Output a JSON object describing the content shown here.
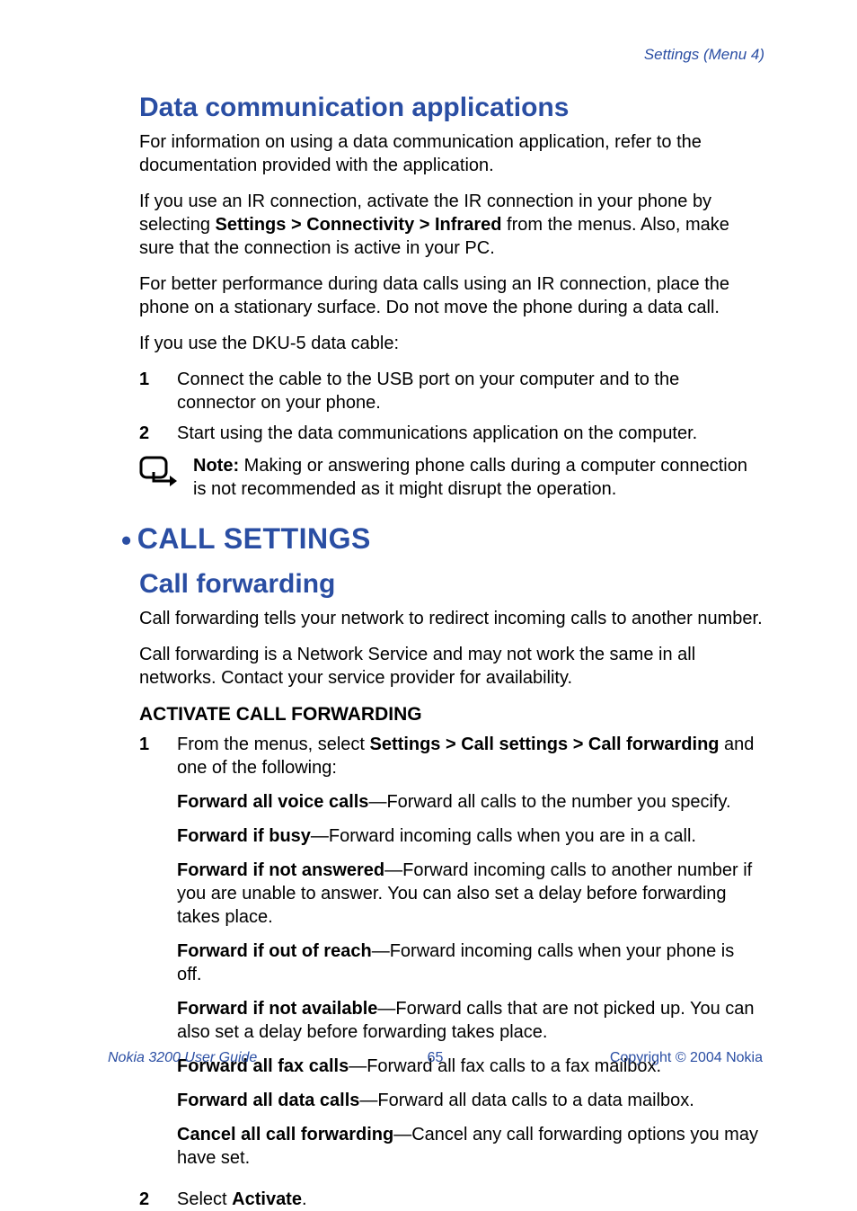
{
  "header": {
    "right": "Settings (Menu 4)"
  },
  "s1": {
    "title": "Data communication applications",
    "p1": "For information on using a data communication application, refer to the documentation provided with the application.",
    "p2a": "If you use an IR connection, activate the IR connection in your phone by selecting ",
    "p2b": "Settings > Connectivity > Infrared",
    "p2c": " from the menus. Also, make sure that the connection is active in your PC.",
    "p3": "For better performance during data calls using an IR connection, place the phone on a stationary surface. Do not move the phone during a data call.",
    "p4": "If you use the DKU-5 data cable:",
    "list": [
      {
        "num": "1",
        "text": "Connect the cable to the USB port on your computer and to the connector on your phone."
      },
      {
        "num": "2",
        "text": "Start using the data communications application on the computer."
      }
    ],
    "note_label": "Note:",
    "note_text": " Making or answering phone calls during a computer connection is not recommended as it might disrupt the operation."
  },
  "s2": {
    "main_title": "CALL SETTINGS",
    "sub_title": "Call forwarding",
    "p1": "Call forwarding tells your network to redirect incoming calls to another number.",
    "p2": "Call forwarding is a Network Service and may not work the same in all networks. Contact your service provider for availability.",
    "h3": "ACTIVATE CALL FORWARDING",
    "step1_num": "1",
    "step1a": "From the menus, select ",
    "step1b": "Settings > Call settings > Call forwarding",
    "step1c": " and one of the following:",
    "opts": [
      {
        "b": "Forward all voice calls",
        "t": "—Forward all calls to the number you specify."
      },
      {
        "b": "Forward if busy",
        "t": "—Forward incoming calls when you are in a call."
      },
      {
        "b": "Forward if not answered",
        "t": "—Forward incoming calls to another number if you are unable to answer. You can also set a delay before forwarding takes place."
      },
      {
        "b": "Forward if out of reach",
        "t": "—Forward incoming calls when your phone is off."
      },
      {
        "b": "Forward if not available",
        "t": "—Forward calls that are not picked up. You can also set a delay before forwarding takes place."
      },
      {
        "b": "Forward all fax calls",
        "t": "—Forward all fax calls to a fax mailbox."
      },
      {
        "b": "Forward all data calls",
        "t": "—Forward all data calls to a data mailbox."
      },
      {
        "b": "Cancel all call forwarding",
        "t": "—Cancel any call forwarding options you may have set."
      }
    ],
    "step2_num": "2",
    "step2a": "Select ",
    "step2b": "Activate",
    "step2c": "."
  },
  "footer": {
    "left": "Nokia 3200 User Guide",
    "center": "65",
    "right": "Copyright © 2004 Nokia"
  }
}
